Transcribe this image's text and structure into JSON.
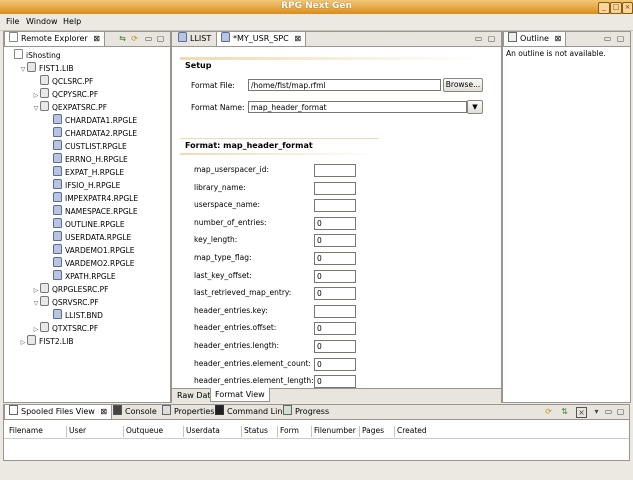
{
  "window": {
    "title": "RPG Next Gen"
  },
  "menu": [
    {
      "label": "File"
    },
    {
      "label": "Window"
    },
    {
      "label": "Help"
    }
  ],
  "remote_explorer": {
    "tab_label": "Remote Explorer",
    "tree": [
      {
        "label": "iShosting",
        "level": 0,
        "kind": "server",
        "toggle": ""
      },
      {
        "label": "FIST1.LIB",
        "level": 1,
        "kind": "lib",
        "toggle": "▽"
      },
      {
        "label": "QCLSRC.PF",
        "level": 2,
        "kind": "lib",
        "toggle": ""
      },
      {
        "label": "QCPYSRC.PF",
        "level": 2,
        "kind": "lib",
        "toggle": "▷"
      },
      {
        "label": "QEXPATSRC.PF",
        "level": 2,
        "kind": "lib",
        "toggle": "▽"
      },
      {
        "label": "CHARDATA1.RPGLE",
        "level": 3,
        "kind": "file",
        "toggle": ""
      },
      {
        "label": "CHARDATA2.RPGLE",
        "level": 3,
        "kind": "file",
        "toggle": ""
      },
      {
        "label": "CUSTLIST.RPGLE",
        "level": 3,
        "kind": "file",
        "toggle": ""
      },
      {
        "label": "ERRNO_H.RPGLE",
        "level": 3,
        "kind": "file",
        "toggle": ""
      },
      {
        "label": "EXPAT_H.RPGLE",
        "level": 3,
        "kind": "file",
        "toggle": ""
      },
      {
        "label": "IFSIO_H.RPGLE",
        "level": 3,
        "kind": "file",
        "toggle": ""
      },
      {
        "label": "IMPEXPATR4.RPGLE",
        "level": 3,
        "kind": "file",
        "toggle": ""
      },
      {
        "label": "NAMESPACE.RPGLE",
        "level": 3,
        "kind": "file",
        "toggle": ""
      },
      {
        "label": "OUTLINE.RPGLE",
        "level": 3,
        "kind": "file",
        "toggle": ""
      },
      {
        "label": "USERDATA.RPGLE",
        "level": 3,
        "kind": "file",
        "toggle": ""
      },
      {
        "label": "VARDEMO1.RPGLE",
        "level": 3,
        "kind": "file",
        "toggle": ""
      },
      {
        "label": "VARDEMO2.RPGLE",
        "level": 3,
        "kind": "file",
        "toggle": ""
      },
      {
        "label": "XPATH.RPGLE",
        "level": 3,
        "kind": "file",
        "toggle": ""
      },
      {
        "label": "QRPGLESRC.PF",
        "level": 2,
        "kind": "lib",
        "toggle": "▷"
      },
      {
        "label": "QSRVSRC.PF",
        "level": 2,
        "kind": "lib",
        "toggle": "▽"
      },
      {
        "label": "LLIST.BND",
        "level": 3,
        "kind": "file",
        "toggle": ""
      },
      {
        "label": "QTXTSRC.PF",
        "level": 2,
        "kind": "lib",
        "toggle": "▷"
      },
      {
        "label": "FIST2.LIB",
        "level": 1,
        "kind": "lib",
        "toggle": "▷"
      }
    ]
  },
  "editor": {
    "tabs": [
      {
        "label": "LLIST",
        "active": false
      },
      {
        "label": "*MY_USR_SPC",
        "active": true
      }
    ],
    "setup": {
      "title": "Setup",
      "format_file_label": "Format File:",
      "format_file_value": "/home/fist/map.rfml",
      "browse_label": "Browse...",
      "format_name_label": "Format Name:",
      "format_name_value": "map_header_format"
    },
    "format": {
      "title": "Format: map_header_format",
      "fields": [
        {
          "label": "map_userspacer_id:",
          "value": ""
        },
        {
          "label": "library_name:",
          "value": ""
        },
        {
          "label": "userspace_name:",
          "value": ""
        },
        {
          "label": "number_of_entries:",
          "value": "0"
        },
        {
          "label": "key_length:",
          "value": "0"
        },
        {
          "label": "map_type_flag:",
          "value": "0"
        },
        {
          "label": "last_key_offset:",
          "value": "0"
        },
        {
          "label": "last_retrieved_map_entry:",
          "value": "0"
        },
        {
          "label": "header_entries.key:",
          "value": ""
        },
        {
          "label": "header_entries.offset:",
          "value": "0"
        },
        {
          "label": "header_entries.length:",
          "value": "0"
        },
        {
          "label": "header_entries.element_count:",
          "value": "0"
        },
        {
          "label": "header_entries.element_length:",
          "value": "0"
        }
      ]
    },
    "bottom_tabs": [
      {
        "label": "Raw Data",
        "active": false
      },
      {
        "label": "Format View",
        "active": true
      }
    ]
  },
  "outline": {
    "tab_label": "Outline",
    "message": "An outline is not available."
  },
  "bottom": {
    "tabs": [
      {
        "label": "Spooled Files View",
        "active": true
      },
      {
        "label": "Console",
        "active": false
      },
      {
        "label": "Properties",
        "active": false
      },
      {
        "label": "Command Line",
        "active": false
      },
      {
        "label": "Progress",
        "active": false
      }
    ],
    "columns": [
      "Filename",
      "User",
      "Outqueue",
      "Userdata",
      "Status",
      "Form",
      "Filenumber",
      "Pages",
      "Created"
    ]
  },
  "colors": {
    "title_bar": "#e1a33a",
    "panel_border": "#9a968f",
    "section_header": "#f2d9b0"
  }
}
